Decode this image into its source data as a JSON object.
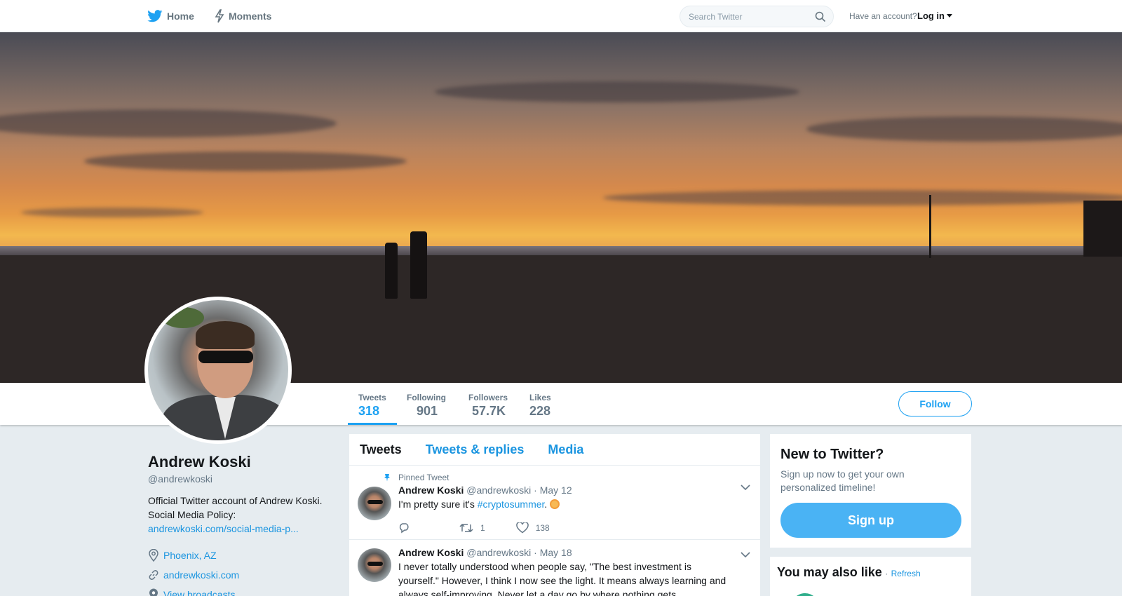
{
  "nav": {
    "home_label": "Home",
    "moments_label": "Moments",
    "search_placeholder": "Search Twitter",
    "account_prompt": "Have an account?",
    "login_label": "Log in"
  },
  "profile": {
    "name": "Andrew Koski",
    "handle": "@andrewkoski",
    "bio_line1": "Official Twitter account of Andrew Koski.",
    "bio_line2": "Social Media Policy:",
    "bio_link": "andrewkoski.com/social-media-p...",
    "location": "Phoenix, AZ",
    "website": "andrewkoski.com",
    "broadcasts": "View broadcasts"
  },
  "stats": {
    "tweets_label": "Tweets",
    "tweets_value": "318",
    "following_label": "Following",
    "following_value": "901",
    "followers_label": "Followers",
    "followers_value": "57.7K",
    "likes_label": "Likes",
    "likes_value": "228",
    "follow_label": "Follow"
  },
  "timeline": {
    "tabs": [
      "Tweets",
      "Tweets & replies",
      "Media"
    ],
    "pinned_label": "Pinned Tweet",
    "tweets": [
      {
        "author": "Andrew Koski",
        "handle": "@andrewkoski",
        "date": "· May 12",
        "text_before": "I'm pretty sure it's ",
        "hashtag": "#cryptosummer",
        "text_after": ".",
        "retweets": "1",
        "likes": "138"
      },
      {
        "author": "Andrew Koski",
        "handle": "@andrewkoski",
        "date": "· May 18",
        "text": "I never totally understood when people say, \"The best investment is yourself.\" However, I think I now see the light. It means always learning and always self-improving. Never let a day go by where nothing gets accomplished."
      }
    ]
  },
  "sidebar": {
    "signup_title": "New to Twitter?",
    "signup_text": "Sign up now to get your own personalized timeline!",
    "signup_button": "Sign up",
    "wtf_title": "You may also like",
    "wtf_separator": "·",
    "wtf_refresh": "Refresh"
  },
  "colors": {
    "accent": "#1da1f2",
    "link": "#1b95e0",
    "signup_button": "#4ab3f4",
    "page_background": "#e6ecf0"
  }
}
